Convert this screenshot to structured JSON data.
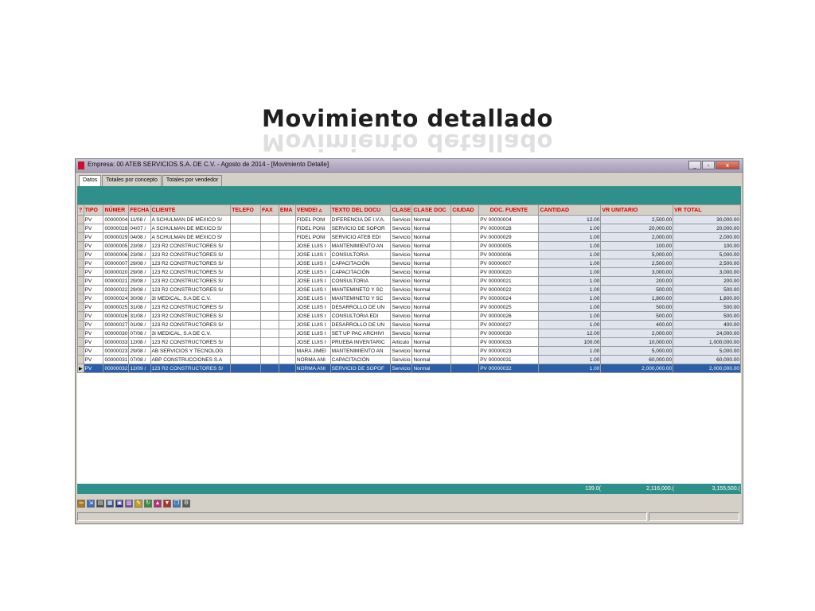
{
  "slide": {
    "title": "Movimiento detallado"
  },
  "window": {
    "title": "Empresa: 00 ATEB SERVICIOS S.A. DE C.V. - Agosto de 2014 - [Movimiento Detalle]",
    "min_glyph": "_",
    "max_glyph": "▫",
    "close_glyph": "x"
  },
  "tabs": [
    "Datos",
    "Totales por concepto",
    "Totales por vendedor"
  ],
  "columns": [
    "TIPO",
    "NÚMER",
    "FECHA",
    "CLIENTE",
    "TELEFO",
    "FAX",
    "EMA",
    "VENDEI ▵",
    "TEXTO DEL DOCU",
    "CLASE",
    "CLASE DOC",
    "CIUDAD",
    "DOC. FUENTE",
    "CANTIDAD",
    "VR UNITARIO",
    "VR TOTAL"
  ],
  "indicator_header": "?",
  "rows": [
    {
      "tipo": "PV",
      "numero": "00000004",
      "fecha": "11/08 /",
      "cliente": "A SCHULMAN DE MEXICO S/",
      "telefono": "",
      "fax": "",
      "email": "",
      "vendedor": "FIDEL PONI",
      "texto": "DIFERENCIA DE I.V.A.",
      "clase": "Servicio",
      "clase_doc": "Normal",
      "ciudad": "",
      "doc_fuente": "PV 00000004",
      "cantidad": "12.00",
      "vr_unitario": "2,500.00",
      "vr_total": "30,000.00"
    },
    {
      "tipo": "PV",
      "numero": "00000028",
      "fecha": "04/07 /",
      "cliente": "A SCHULMAN DE MEXICO S/",
      "telefono": "",
      "fax": "",
      "email": "",
      "vendedor": "FIDEL PONI",
      "texto": "SERVICIO DE SOPOR",
      "clase": "Servicio",
      "clase_doc": "Normal",
      "ciudad": "",
      "doc_fuente": "PV 00000028",
      "cantidad": "1.00",
      "vr_unitario": "20,000.00",
      "vr_total": "20,000.00"
    },
    {
      "tipo": "PV",
      "numero": "00000029",
      "fecha": "04/08 /",
      "cliente": "A SCHULMAN DE MEXICO S/",
      "telefono": "",
      "fax": "",
      "email": "",
      "vendedor": "FIDEL PONI",
      "texto": "SERVICIO ATEB EDI",
      "clase": "Servicio",
      "clase_doc": "Normal",
      "ciudad": "",
      "doc_fuente": "PV 00000029",
      "cantidad": "1.00",
      "vr_unitario": "2,000.00",
      "vr_total": "2,000.00"
    },
    {
      "tipo": "PV",
      "numero": "00000005",
      "fecha": "23/08 /",
      "cliente": "123 R2 CONSTRUCTORES S/",
      "telefono": "",
      "fax": "",
      "email": "",
      "vendedor": "JOSE LUIS I",
      "texto": "MANTENIMIENTO AN",
      "clase": "Servicio",
      "clase_doc": "Normal",
      "ciudad": "",
      "doc_fuente": "PV 00000005",
      "cantidad": "1.00",
      "vr_unitario": "100.00",
      "vr_total": "100.00"
    },
    {
      "tipo": "PV",
      "numero": "00000006",
      "fecha": "23/08 /",
      "cliente": "123 R2 CONSTRUCTORES S/",
      "telefono": "",
      "fax": "",
      "email": "",
      "vendedor": "JOSE LUIS I",
      "texto": "CONSULTORIA",
      "clase": "Servicio",
      "clase_doc": "Normal",
      "ciudad": "",
      "doc_fuente": "PV 00000006",
      "cantidad": "1.00",
      "vr_unitario": "5,000.00",
      "vr_total": "5,000.00"
    },
    {
      "tipo": "PV",
      "numero": "00000007",
      "fecha": "29/08 /",
      "cliente": "123 R2 CONSTRUCTORES S/",
      "telefono": "",
      "fax": "",
      "email": "",
      "vendedor": "JOSE LUIS I",
      "texto": "CAPACITACIÓN",
      "clase": "Servicio",
      "clase_doc": "Normal",
      "ciudad": "",
      "doc_fuente": "PV 00000007",
      "cantidad": "1.00",
      "vr_unitario": "2,500.00",
      "vr_total": "2,500.00"
    },
    {
      "tipo": "PV",
      "numero": "00000020",
      "fecha": "29/08 /",
      "cliente": "123 R2 CONSTRUCTORES S/",
      "telefono": "",
      "fax": "",
      "email": "",
      "vendedor": "JOSE LUIS I",
      "texto": "CAPACITACIÓN",
      "clase": "Servicio",
      "clase_doc": "Normal",
      "ciudad": "",
      "doc_fuente": "PV 00000020",
      "cantidad": "1.00",
      "vr_unitario": "3,000.00",
      "vr_total": "3,000.00"
    },
    {
      "tipo": "PV",
      "numero": "00000021",
      "fecha": "29/08 /",
      "cliente": "123 R2 CONSTRUCTORES S/",
      "telefono": "",
      "fax": "",
      "email": "",
      "vendedor": "JOSE LUIS I",
      "texto": "CONSULTORIA",
      "clase": "Servicio",
      "clase_doc": "Normal",
      "ciudad": "",
      "doc_fuente": "PV 00000021",
      "cantidad": "1.00",
      "vr_unitario": "200.00",
      "vr_total": "200.00"
    },
    {
      "tipo": "PV",
      "numero": "00000022",
      "fecha": "29/08 /",
      "cliente": "123 R2 CONSTRUCTORES S/",
      "telefono": "",
      "fax": "",
      "email": "",
      "vendedor": "JOSE LUIS I",
      "texto": "MANTEMINETO Y SC",
      "clase": "Servicio",
      "clase_doc": "Normal",
      "ciudad": "",
      "doc_fuente": "PV 00000022",
      "cantidad": "1.00",
      "vr_unitario": "500.00",
      "vr_total": "500.00"
    },
    {
      "tipo": "PV",
      "numero": "00000024",
      "fecha": "30/08 /",
      "cliente": "3I MEDICAL, S.A DE C.V.",
      "telefono": "",
      "fax": "",
      "email": "",
      "vendedor": "JOSE LUIS I",
      "texto": "MANTEMINETO Y SC",
      "clase": "Servicio",
      "clase_doc": "Normal",
      "ciudad": "",
      "doc_fuente": "PV 00000024",
      "cantidad": "1.00",
      "vr_unitario": "1,800.00",
      "vr_total": "1,800.00"
    },
    {
      "tipo": "PV",
      "numero": "00000025",
      "fecha": "31/08 /",
      "cliente": "123 R2 CONSTRUCTORES S/",
      "telefono": "",
      "fax": "",
      "email": "",
      "vendedor": "JOSE LUIS I",
      "texto": "DESARROLLO DE UN",
      "clase": "Servicio",
      "clase_doc": "Normal",
      "ciudad": "",
      "doc_fuente": "PV 00000025",
      "cantidad": "1.00",
      "vr_unitario": "500.00",
      "vr_total": "500.00"
    },
    {
      "tipo": "PV",
      "numero": "00000026",
      "fecha": "31/08 /",
      "cliente": "123 R2 CONSTRUCTORES S/",
      "telefono": "",
      "fax": "",
      "email": "",
      "vendedor": "JOSE LUIS I",
      "texto": "CONSULTORIA EDI",
      "clase": "Servicio",
      "clase_doc": "Normal",
      "ciudad": "",
      "doc_fuente": "PV 00000026",
      "cantidad": "1.00",
      "vr_unitario": "500.00",
      "vr_total": "500.00"
    },
    {
      "tipo": "PV",
      "numero": "00000027",
      "fecha": "01/08 /",
      "cliente": "123 R2 CONSTRUCTORES S/",
      "telefono": "",
      "fax": "",
      "email": "",
      "vendedor": "JOSE LUIS I",
      "texto": "DESARROLLO DE UN",
      "clase": "Servicio",
      "clase_doc": "Normal",
      "ciudad": "",
      "doc_fuente": "PV 00000027",
      "cantidad": "1.00",
      "vr_unitario": "400.00",
      "vr_total": "400.00"
    },
    {
      "tipo": "PV",
      "numero": "00000030",
      "fecha": "07/08 /",
      "cliente": "3I MEDICAL, S.A DE C.V.",
      "telefono": "",
      "fax": "",
      "email": "",
      "vendedor": "JOSE LUIS I",
      "texto": "SET UP PAC ARCHIVI",
      "clase": "Servicio",
      "clase_doc": "Normal",
      "ciudad": "",
      "doc_fuente": "PV 00000030",
      "cantidad": "12.00",
      "vr_unitario": "2,000.00",
      "vr_total": "24,000.00"
    },
    {
      "tipo": "PV",
      "numero": "00000033",
      "fecha": "12/08 /",
      "cliente": "123 R2 CONSTRUCTORES S/",
      "telefono": "",
      "fax": "",
      "email": "",
      "vendedor": "JOSE LUIS I",
      "texto": "PRUEBA INVENTARIC",
      "clase": "Articulo",
      "clase_doc": "Normal",
      "ciudad": "",
      "doc_fuente": "PV 00000033",
      "cantidad": "100.00",
      "vr_unitario": "10,000.00",
      "vr_total": "1,000,000.00"
    },
    {
      "tipo": "PV",
      "numero": "00000023",
      "fecha": "29/08 /",
      "cliente": "AB SERVICIOS Y TECNOLOG",
      "telefono": "",
      "fax": "",
      "email": "",
      "vendedor": "MARA JIMEI",
      "texto": "MANTENIMIENTO AN",
      "clase": "Servicio",
      "clase_doc": "Normal",
      "ciudad": "",
      "doc_fuente": "PV 00000023",
      "cantidad": "1.00",
      "vr_unitario": "5,000.00",
      "vr_total": "5,000.00"
    },
    {
      "tipo": "PV",
      "numero": "00000031",
      "fecha": "07/08 /",
      "cliente": "ABP CONSTRUCCIONES S.A",
      "telefono": "",
      "fax": "",
      "email": "",
      "vendedor": "NORMA ANI",
      "texto": "CAPACITACIÓN",
      "clase": "Servicio",
      "clase_doc": "Normal",
      "ciudad": "",
      "doc_fuente": "PV 00000031",
      "cantidad": "1.00",
      "vr_unitario": "60,000.00",
      "vr_total": "60,000.00"
    },
    {
      "tipo": "PV",
      "numero": "00000032",
      "fecha": "12/09 /",
      "cliente": "123 R2 CONSTRUCTORES S/",
      "telefono": "",
      "fax": "",
      "email": "",
      "vendedor": "NORMA ANI",
      "texto": "SERVICIO DE SOPOF",
      "clase": "Servicio",
      "clase_doc": "Normal",
      "ciudad": "",
      "doc_fuente": "PV 00000032",
      "cantidad": "1.00",
      "vr_unitario": "2,000,000.00",
      "vr_total": "2,000,000.00",
      "selected": true
    }
  ],
  "selected_marker": "▶",
  "totals": {
    "cantidad": "139.0(",
    "vr_unitario": "2,116,000.(",
    "vr_total": "3,155,500.("
  },
  "toolbar_icons": [
    "exit-icon",
    "export-icon",
    "document-icon",
    "print-icon",
    "save-icon",
    "report-icon",
    "edit-icon",
    "refresh-icon",
    "chart-icon",
    "filter-icon",
    "copy-icon",
    "settings-icon"
  ],
  "colors": {
    "header_text": "#e00000",
    "teal": "#2f8f8a",
    "selection": "#2a5ea7"
  }
}
